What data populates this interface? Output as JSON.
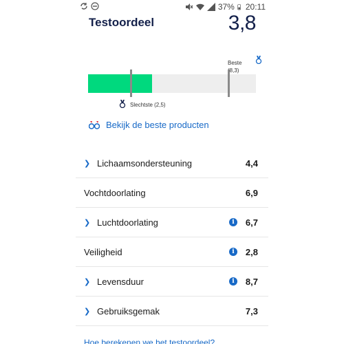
{
  "status_bar": {
    "battery": "37%",
    "time": "20:11"
  },
  "header": {
    "title": "Testoordeel",
    "score": "3,8"
  },
  "score_bar": {
    "score": 3.8,
    "best": 8.3,
    "worst": 2.5,
    "max": 10,
    "best_label_line1": "Beste",
    "best_label_line2": "(8,3)",
    "worst_label": "Slechtste (2,5)",
    "fill_color": "#00d97e",
    "track_color": "#eeeeee"
  },
  "best_products_link": "Bekijk de beste producten",
  "criteria": [
    {
      "label": "Lichaamsondersteuning",
      "value": "4,4",
      "expandable": true,
      "info": false
    },
    {
      "label": "Vochtdoorlating",
      "value": "6,9",
      "expandable": false,
      "info": false
    },
    {
      "label": "Luchtdoorlating",
      "value": "6,7",
      "expandable": true,
      "info": true
    },
    {
      "label": "Veiligheid",
      "value": "2,8",
      "expandable": false,
      "info": true
    },
    {
      "label": "Levensduur",
      "value": "8,7",
      "expandable": true,
      "info": true
    },
    {
      "label": "Gebruiksgemak",
      "value": "7,3",
      "expandable": true,
      "info": false
    }
  ],
  "footer_link": "Hoe berekenen we het testoordeel?",
  "icons": {
    "expand": "chevron-right-icon",
    "info": "info-icon",
    "medal": "medal-icon",
    "compare": "compare-icon"
  }
}
